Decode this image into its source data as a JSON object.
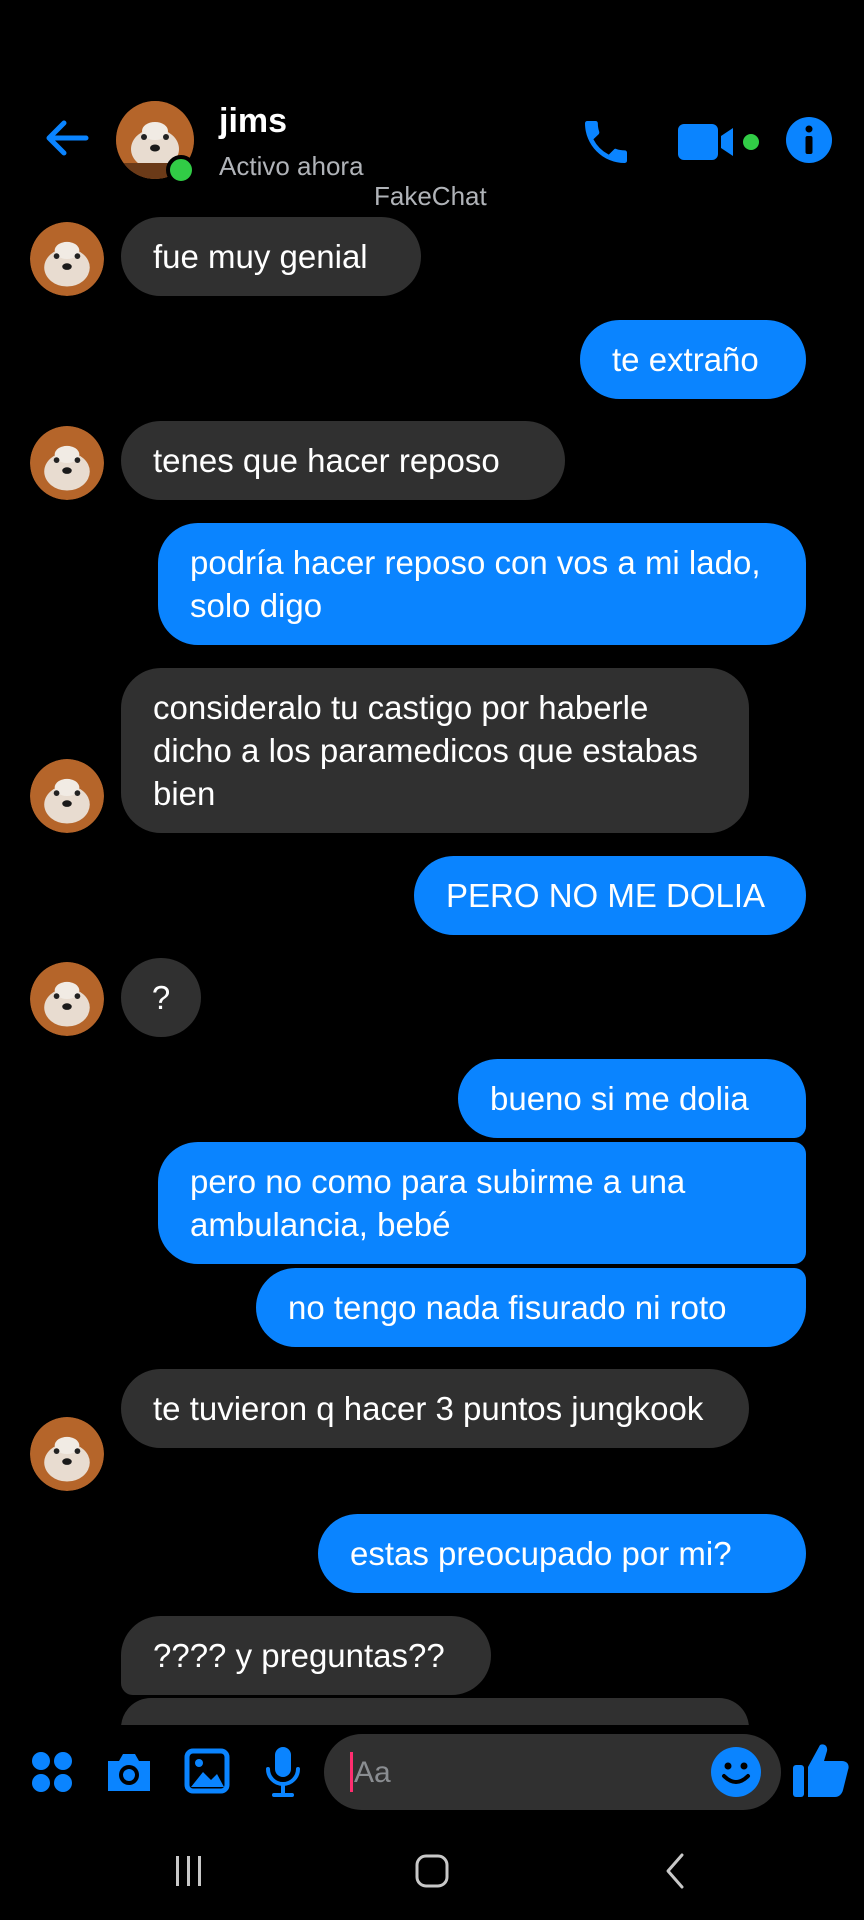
{
  "colors": {
    "accent": "#0a84ff",
    "incoming_bubble": "#303030",
    "online": "#31cc46",
    "background": "#000000"
  },
  "header": {
    "contact_name": "jims",
    "status": "Activo ahora",
    "watermark": "FakeChat",
    "icons": [
      "back-arrow-icon",
      "phone-icon",
      "video-camera-icon",
      "info-icon"
    ]
  },
  "messages": [
    {
      "side": "in",
      "text": "fue muy genial"
    },
    {
      "side": "out",
      "text": "te extraño"
    },
    {
      "side": "in",
      "text": "tenes que hacer reposo"
    },
    {
      "side": "out",
      "text": "podría hacer reposo con vos a mi lado, solo digo"
    },
    {
      "side": "in",
      "text": "consideralo tu castigo por haberle dicho a los paramedicos que estabas bien"
    },
    {
      "side": "out",
      "text": "PERO NO ME DOLIA"
    },
    {
      "side": "in",
      "text": "?"
    },
    {
      "side": "out",
      "text": "bueno si me dolia"
    },
    {
      "side": "out",
      "text": "pero no como para subirme a una ambulancia, bebé"
    },
    {
      "side": "out",
      "text": "no tengo nada fisurado ni roto"
    },
    {
      "side": "in",
      "text": "te tuvieron q hacer 3 puntos jungkook"
    },
    {
      "side": "out",
      "text": "estas preocupado por mi?"
    },
    {
      "side": "in",
      "text": "???? y preguntas??"
    }
  ],
  "composer": {
    "placeholder": "Aa",
    "icons": [
      "apps-grid-icon",
      "camera-icon",
      "gallery-icon",
      "microphone-icon",
      "emoji-icon",
      "thumbs-up-icon"
    ]
  },
  "system_nav": {
    "icons": [
      "recent-apps-icon",
      "home-icon",
      "back-icon"
    ]
  }
}
